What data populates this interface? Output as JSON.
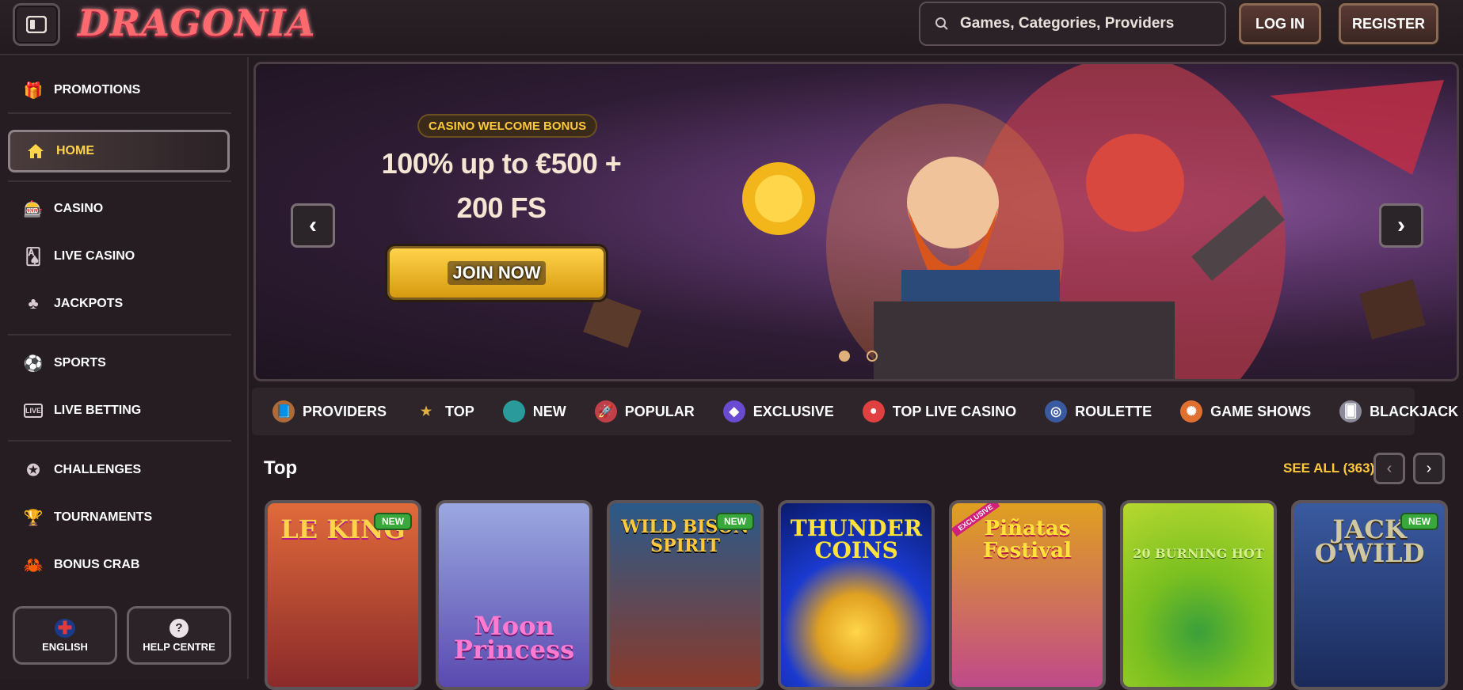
{
  "header": {
    "logo_text": "DRAGONIA",
    "search_placeholder": "Games, Categories, Providers",
    "login_label": "LOG IN",
    "register_label": "REGISTER"
  },
  "sidebar": {
    "items": [
      {
        "label": "PROMOTIONS",
        "icon": "gift-icon"
      },
      {
        "label": "HOME",
        "icon": "home-icon"
      },
      {
        "label": "CASINO",
        "icon": "slot-machine-icon"
      },
      {
        "label": "LIVE CASINO",
        "icon": "card-icon"
      },
      {
        "label": "JACKPOTS",
        "icon": "clover-icon"
      },
      {
        "label": "SPORTS",
        "icon": "ball-icon"
      },
      {
        "label": "LIVE BETTING",
        "icon": "live-icon"
      },
      {
        "label": "CHALLENGES",
        "icon": "badge-icon"
      },
      {
        "label": "TOURNAMENTS",
        "icon": "trophy-icon"
      },
      {
        "label": "BONUS CRAB",
        "icon": "crab-icon"
      }
    ],
    "language_label": "ENGLISH",
    "help_label": "HELP CENTRE"
  },
  "banner": {
    "badge": "CASINO WELCOME BONUS",
    "headline_line1": "100% up to €500 +",
    "headline_line2": "200 FS",
    "cta_label": "JOIN NOW",
    "slides_total": 2,
    "active_slide": 1
  },
  "categories": [
    {
      "label": "PROVIDERS",
      "color": "#b06a3a"
    },
    {
      "label": "TOP",
      "color": "#e0b040"
    },
    {
      "label": "NEW",
      "color": "#2a9a9a"
    },
    {
      "label": "POPULAR",
      "color": "#c0404a"
    },
    {
      "label": "EXCLUSIVE",
      "color": "#6a4ad0"
    },
    {
      "label": "TOP LIVE CASINO",
      "color": "#e04040"
    },
    {
      "label": "ROULETTE",
      "color": "#3a5aa0"
    },
    {
      "label": "GAME SHOWS",
      "color": "#e07030"
    },
    {
      "label": "BLACKJACK",
      "color": "#8a8a9a"
    }
  ],
  "section": {
    "title": "Top",
    "see_all": "SEE ALL (363)"
  },
  "games": [
    {
      "name": "LE KING",
      "badge": "NEW",
      "bg": "#c0563a"
    },
    {
      "name": "Moon Princess",
      "badge": "",
      "bg": "#4a5ad0"
    },
    {
      "name": "WILD BISON SPIRIT",
      "badge": "NEW",
      "bg": "#3a6aa0"
    },
    {
      "name": "THUNDER COINS",
      "badge": "",
      "bg": "#1a4ad0"
    },
    {
      "name": "Piñatas Festival",
      "badge": "EXCLUSIVE",
      "bg": "#e0a020"
    },
    {
      "name": "20 BURNING HOT",
      "badge": "",
      "bg": "#7ac020"
    },
    {
      "name": "JACK O'WILD",
      "badge": "NEW",
      "bg": "#2a4a8a"
    }
  ]
}
